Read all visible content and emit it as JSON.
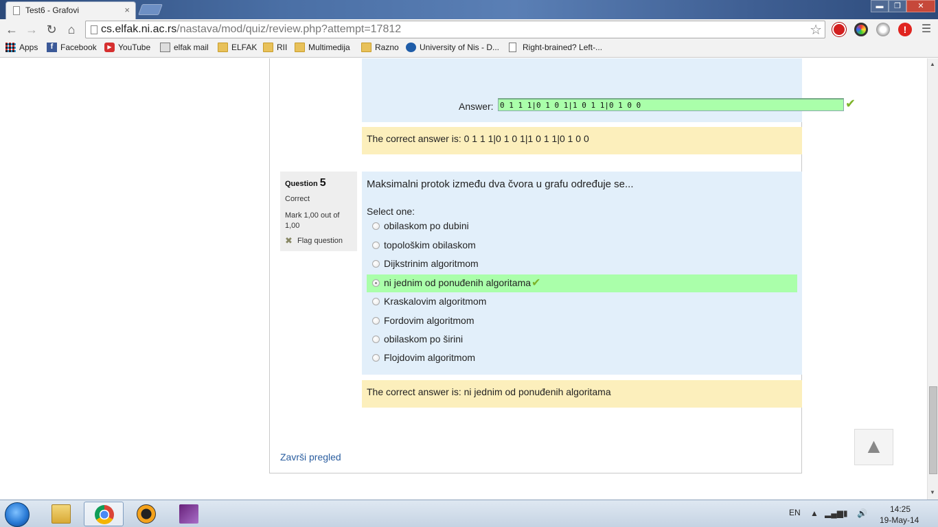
{
  "browser": {
    "tab_title": "Test6 - Grafovi",
    "tab_close": "×",
    "window_buttons": {
      "minimize": "▬",
      "maximize": "❐",
      "close": "✕"
    },
    "url_host": "cs.elfak.ni.ac.rs",
    "url_path": "/nastava/mod/quiz/review.php?attempt=17812",
    "bookmarks": [
      "Apps",
      "Facebook",
      "YouTube",
      "elfak mail",
      "ELFAK",
      "RII",
      "Multimedija",
      "Razno",
      "University of Nis - D...",
      "Right-brained? Left-..."
    ]
  },
  "question4": {
    "answer_label": "Answer:",
    "answer_value": "0 1 1 1|0 1 0 1|1 0 1 1|0 1 0 0",
    "correct_answer": "The correct answer is: 0 1 1 1|0 1 0 1|1 0 1 1|0 1 0 0"
  },
  "question5": {
    "title_prefix": "Question",
    "number": "5",
    "state": "Correct",
    "mark": "Mark 1,00 out of 1,00",
    "flag_label": "Flag question",
    "text": "Maksimalni protok između dva čvora u grafu određuje se...",
    "select_label": "Select one:",
    "options": [
      "obilaskom po dubini",
      "topološkim obilaskom",
      "Dijkstrinim algoritmom",
      "ni jednim od ponuđenih algoritama",
      "Kraskalovim algoritmom",
      "Fordovim algoritmom",
      "obilaskom po širini",
      "Flojdovim algoritmom"
    ],
    "selected_index": 3,
    "correct_answer": "The correct answer is: ni jednim od ponuđenih algoritama"
  },
  "page": {
    "finish_link": "Završi pregled",
    "scroll_top_glyph": "▲"
  },
  "taskbar": {
    "language": "EN",
    "time": "14:25",
    "date": "19-May-14"
  },
  "colors": {
    "content_bg": "#e2effa",
    "feedback_bg": "#fcefbc",
    "correct_bg": "#aaffaa",
    "tick": "#7db32a",
    "link": "#2a5d9f"
  }
}
